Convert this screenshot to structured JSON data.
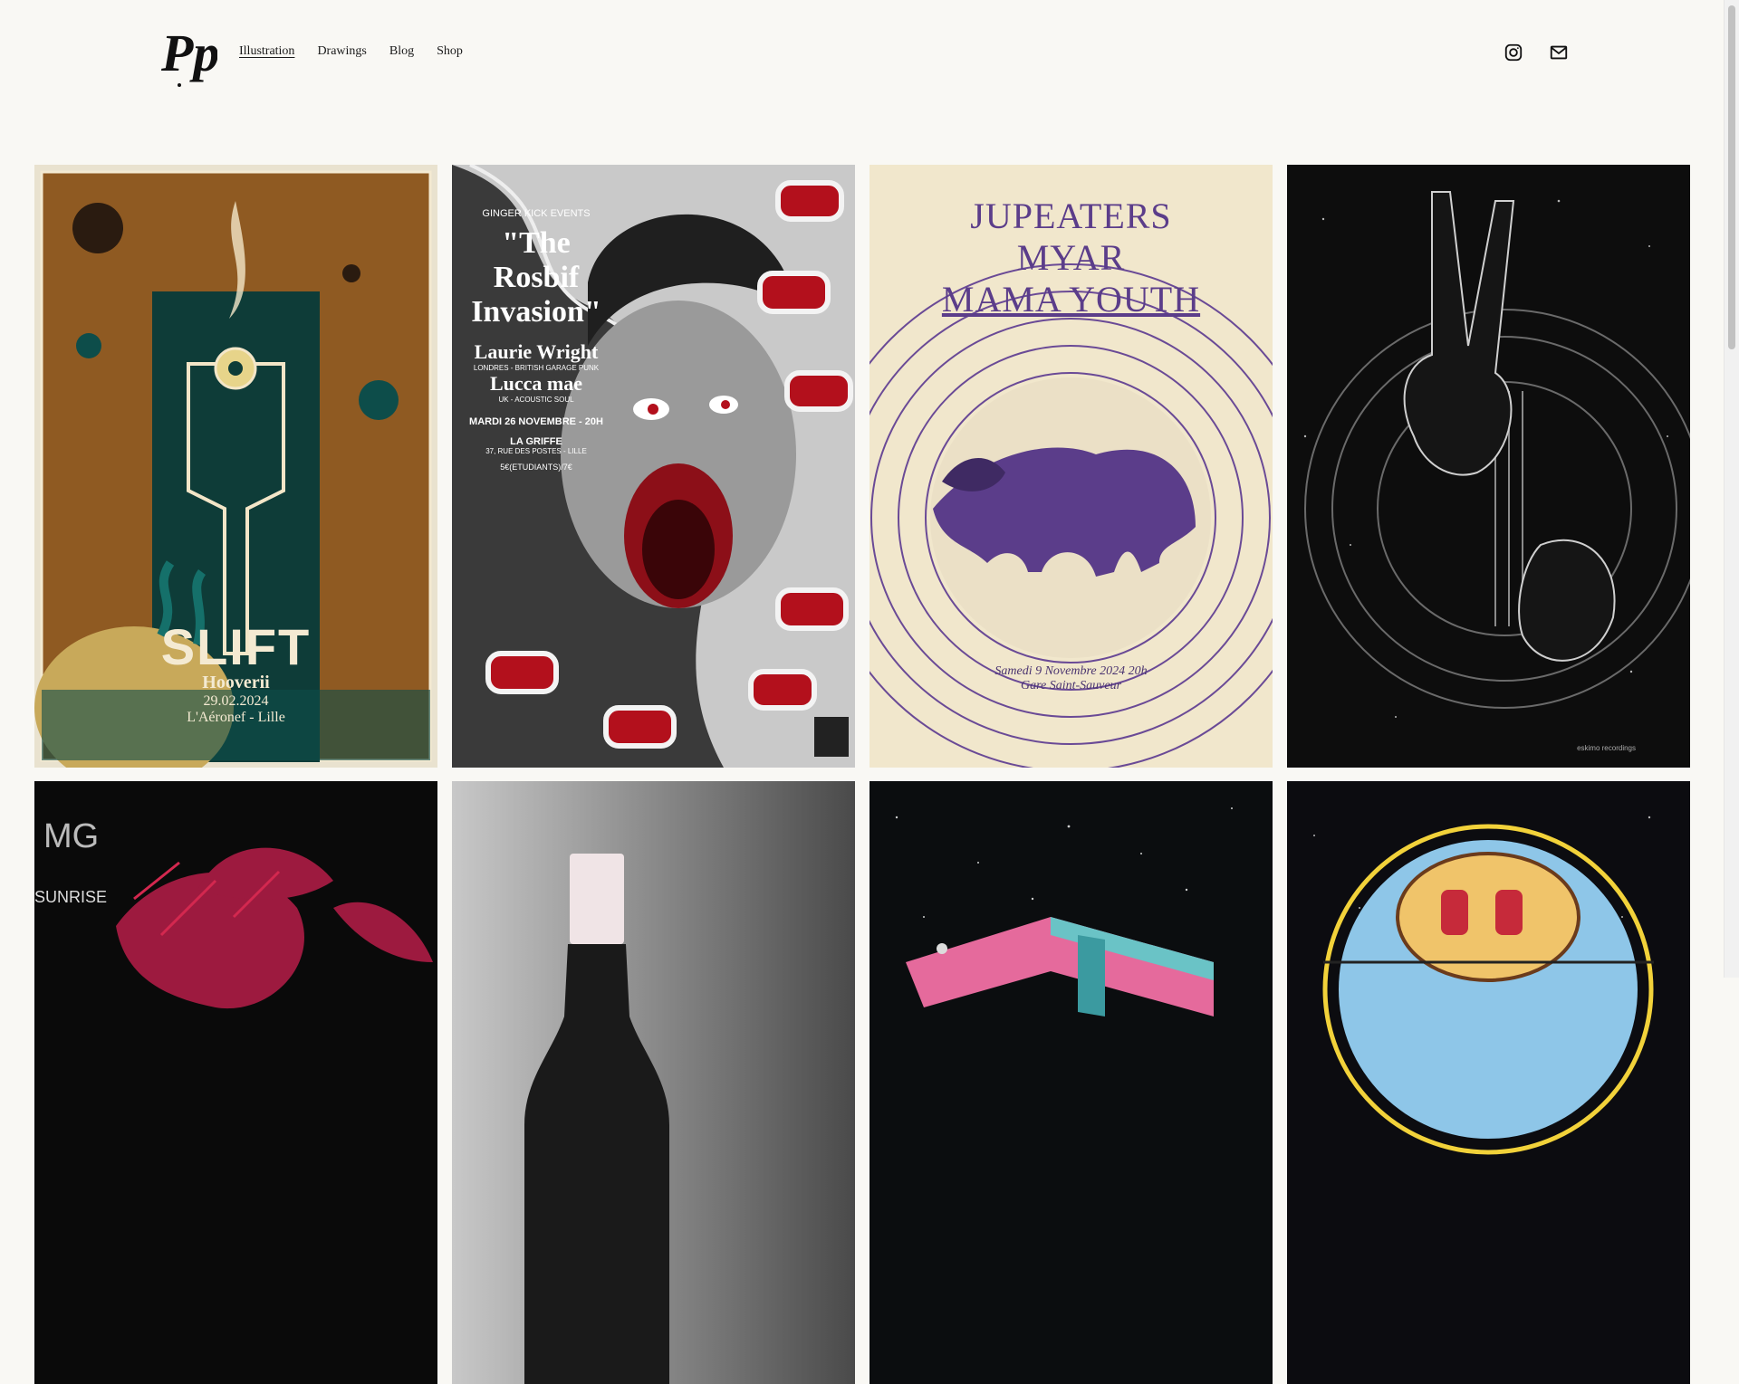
{
  "site": {
    "logo_text": "Pp"
  },
  "nav": {
    "items": [
      {
        "label": "Illustration",
        "active": true
      },
      {
        "label": "Drawings",
        "active": false
      },
      {
        "label": "Blog",
        "active": false
      },
      {
        "label": "Shop",
        "active": false
      }
    ]
  },
  "header_icons": [
    "instagram-icon",
    "email-icon"
  ],
  "gallery": {
    "posters": [
      {
        "title": "SLIFT",
        "subtitle": "Hooverii",
        "date": "29.02.2024",
        "venue": "L'Aéronef - Lille"
      },
      {
        "presenter": "GINGER KICK EVENTS",
        "title_line1": "\"The",
        "title_line2": "Rosbif",
        "title_line3": "Invasion\"",
        "act1": "Laurie Wright",
        "act1_desc": "LONDRES - BRITISH GARAGE PUNK",
        "act2": "Lucca mae",
        "act2_desc": "UK - ACOUSTIC SOUL",
        "date": "MARDI 26 NOVEMBRE - 20H",
        "venue": "LA GRIFFE",
        "address": "37, RUE DES POSTES - LILLE",
        "price": "5€(ETUDIANTS)/7€"
      },
      {
        "band1": "JUPEATERS",
        "band2": "MYAR",
        "band3": "MAMA YOUTH",
        "date": "Samedi 9 Novembre 2024 20h",
        "venue": "Gare Saint-Sauveur"
      },
      {
        "label": "eskimo recordings"
      },
      {
        "label": "SUNRISE",
        "mark": "MG"
      },
      {},
      {},
      {}
    ]
  },
  "colors": {
    "background": "#f9f8f4",
    "text": "#1a1a1a",
    "slift_teal": "#0d4d4a",
    "slift_orange": "#a66a2c",
    "rosbif_red": "#b3101c",
    "jupeaters_purple": "#6a4a96",
    "jupeaters_cream": "#f1e7cc"
  }
}
